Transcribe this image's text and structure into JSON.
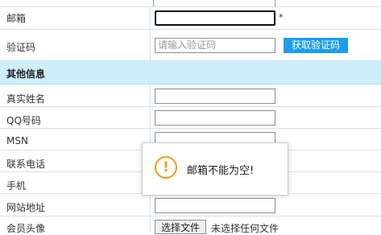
{
  "form": {
    "email_label": "邮箱",
    "required_mark": "*",
    "captcha_label": "验证码",
    "captcha_placeholder": "请输入验证码",
    "captcha_button": "获取验证码",
    "section_other": "其他信息",
    "realname_label": "真实姓名",
    "qq_label": "QQ号码",
    "msn_label": "MSN",
    "phone_label": "联系电话",
    "mobile_label": "手机",
    "website_label": "网站地址",
    "avatar_label": "会员头像",
    "file_button": "选择文件",
    "file_status": "未选择任何文件"
  },
  "alert": {
    "icon": "warning-icon",
    "message": "邮箱不能为空!"
  },
  "colors": {
    "accent_button": "#1e9cf0",
    "section_bg": "#cdeefb",
    "warning": "#f39a12"
  }
}
